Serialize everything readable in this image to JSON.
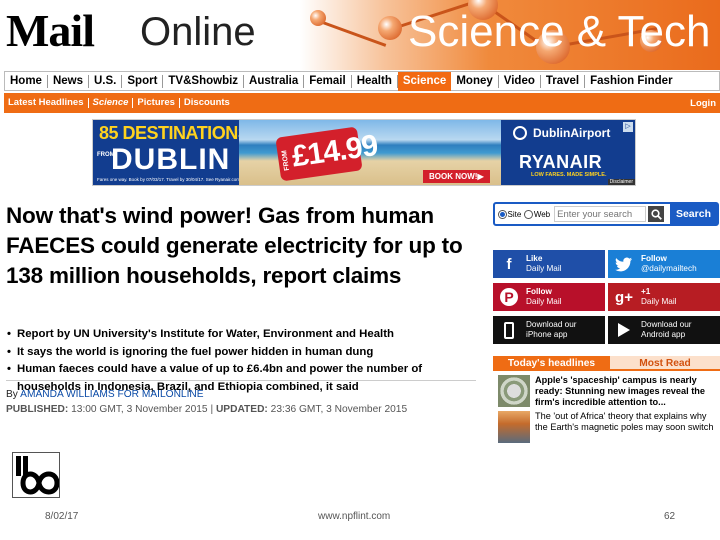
{
  "masthead": {
    "logo_mail": "Mail",
    "logo_online": "Online",
    "section_title": "Science & Tech"
  },
  "nav": {
    "items": [
      "Home",
      "News",
      "U.S.",
      "Sport",
      "TV&Showbiz",
      "Australia",
      "Femail",
      "Health",
      "Science",
      "Money",
      "Video",
      "Travel",
      "Fashion Finder"
    ],
    "active": "Science"
  },
  "subnav": {
    "items": [
      "Latest Headlines",
      "Science",
      "Pictures",
      "Discounts"
    ],
    "login": "Login"
  },
  "ad": {
    "destinations": "85 DESTINATIONS",
    "from": "FROM",
    "city": "DUBLIN",
    "tag_from": "FROM",
    "price": "£14.99",
    "book": "BOOK NOW!▶",
    "airport": "DublinAirport",
    "airline": "RYANAIR",
    "slogan": "LOW FARES. MADE SIMPLE.",
    "fine_print": "Fares one way. Book by 07/03/17. Travel by 30/04/17. See Ryanair.com",
    "disclaimer": "Disclaimer",
    "choice": "▷"
  },
  "article": {
    "headline": "Now that's wind power! Gas from human FAECES could generate electricity for up to 138 million households, report claims",
    "bullets": [
      "Report by UN University's Institute for Water, Environment and Health",
      "It says the world is ignoring the fuel power hidden in human dung",
      "Human faeces could have a value of up to £6.4bn and power the number of households in Indonesia, Brazil, and Ethiopia combined, it said"
    ],
    "by": "By",
    "author": "AMANDA WILLIAMS FOR MAILONLINE",
    "published_label": "PUBLISHED:",
    "published": "13:00 GMT, 3 November 2015",
    "sep": "|",
    "updated_label": "UPDATED:",
    "updated": "23:36 GMT, 3 November 2015"
  },
  "search": {
    "site_label": "Site",
    "web_label": "Web",
    "placeholder": "Enter your search",
    "button": "Search"
  },
  "social": {
    "fb_top": "Like",
    "fb_bottom": "Daily Mail",
    "tw_top": "Follow",
    "tw_bottom": "@dailymailtech",
    "pin_top": "Follow",
    "pin_bottom": "Daily Mail",
    "gp_top": "+1",
    "gp_bottom": "Daily Mail",
    "ios_top": "Download our",
    "ios_bottom": "iPhone app",
    "andr_top": "Download our",
    "andr_bottom": "Android app"
  },
  "headlines": {
    "tab_today": "Today's headlines",
    "tab_most": "Most Read",
    "stories": [
      "Apple's 'spaceship' campus is nearly ready: Stunning new images reveal the firm's incredible attention to...",
      "The 'out of Africa' theory that explains why the Earth's magnetic poles may soon switch"
    ]
  },
  "footer": {
    "date": "8/02/17",
    "url": "www.npflint.com",
    "page": "62"
  },
  "colors": {
    "accent": "#ef6c14",
    "link": "#1a5bc4"
  }
}
